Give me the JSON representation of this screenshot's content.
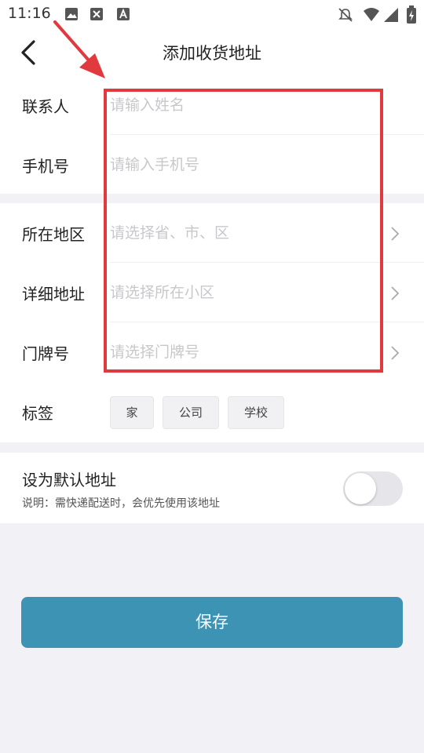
{
  "status_bar": {
    "time": "11:16",
    "icons": [
      "image-icon",
      "screen-cast-icon",
      "a-notification-icon",
      "mute-bell-icon",
      "wifi-icon",
      "signal-icon",
      "battery-charging-icon"
    ]
  },
  "header": {
    "back_icon": "chevron-left-icon",
    "title": "添加收货地址"
  },
  "form": {
    "contact": {
      "label": "联系人",
      "placeholder": "请输入姓名",
      "value": ""
    },
    "phone": {
      "label": "手机号",
      "placeholder": "请输入手机号",
      "value": ""
    },
    "region": {
      "label": "所在地区",
      "placeholder": "请选择省、市、区",
      "value": ""
    },
    "detail": {
      "label": "详细地址",
      "placeholder": "请选择所在小区",
      "value": ""
    },
    "door": {
      "label": "门牌号",
      "placeholder": "请选择门牌号",
      "value": ""
    }
  },
  "tags": {
    "label": "标签",
    "options": [
      "家",
      "公司",
      "学校"
    ]
  },
  "default_address": {
    "title": "设为默认地址",
    "description": "说明：需快递配送时，会优先使用该地址",
    "enabled": false
  },
  "save_label": "保存",
  "annotation": {
    "color": "#e0393e"
  },
  "colors": {
    "accent": "#3d93b4",
    "background": "#f2f1f6"
  }
}
